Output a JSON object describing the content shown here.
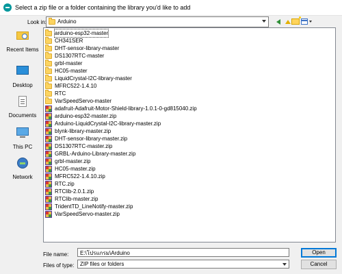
{
  "window": {
    "title": "Select a zip file or a folder containing the library you'd like to add"
  },
  "toolbar": {
    "look_in_label": "Look in:",
    "look_in_value": "Arduino",
    "back_icon": "back-arrow-icon",
    "up_icon": "up-folder-icon",
    "new_folder_icon": "new-folder-icon",
    "view_menu_icon": "view-menu-icon"
  },
  "places": [
    {
      "label": "Recent Items",
      "icon": "recent-items-icon"
    },
    {
      "label": "Desktop",
      "icon": "desktop-icon"
    },
    {
      "label": "Documents",
      "icon": "documents-icon"
    },
    {
      "label": "This PC",
      "icon": "this-pc-icon"
    },
    {
      "label": "Network",
      "icon": "network-icon"
    }
  ],
  "files": [
    {
      "name": "arduino-esp32-master",
      "type": "folder"
    },
    {
      "name": "CH341SER",
      "type": "folder"
    },
    {
      "name": "DHT-sensor-library-master",
      "type": "folder"
    },
    {
      "name": "DS1307RTC-master",
      "type": "folder"
    },
    {
      "name": "grbl-master",
      "type": "folder"
    },
    {
      "name": "HC05-master",
      "type": "folder"
    },
    {
      "name": "LiquidCrystal-I2C-library-master",
      "type": "folder"
    },
    {
      "name": "MFRC522-1.4.10",
      "type": "folder"
    },
    {
      "name": "RTC",
      "type": "folder"
    },
    {
      "name": "VarSpeedServo-master",
      "type": "folder"
    },
    {
      "name": "adafruit-Adafruit-Motor-Shield-library-1.0.1-0-gd815040.zip",
      "type": "zip"
    },
    {
      "name": "arduino-esp32-master.zip",
      "type": "zip"
    },
    {
      "name": "Arduino-LiquidCrystal-I2C-library-master.zip",
      "type": "zip"
    },
    {
      "name": "blynk-library-master.zip",
      "type": "zip"
    },
    {
      "name": "DHT-sensor-library-master.zip",
      "type": "zip"
    },
    {
      "name": "DS1307RTC-master.zip",
      "type": "zip"
    },
    {
      "name": "GRBL-Arduino-Library-master.zip",
      "type": "zip"
    },
    {
      "name": "grbl-master.zip",
      "type": "zip"
    },
    {
      "name": "HC05-master.zip",
      "type": "zip"
    },
    {
      "name": "MFRC522-1.4.10.zip",
      "type": "zip"
    },
    {
      "name": "RTC.zip",
      "type": "zip"
    },
    {
      "name": "RTClib-2.0.1.zip",
      "type": "zip"
    },
    {
      "name": "RTClib-master.zip",
      "type": "zip"
    },
    {
      "name": "TridentTD_LineNotify-master.zip",
      "type": "zip"
    },
    {
      "name": "VarSpeedServo-master.zip",
      "type": "zip"
    }
  ],
  "form": {
    "file_name_label": "File name:",
    "file_name_value": "E:\\โปรแกรม\\Arduino",
    "file_type_label": "Files of type:",
    "file_type_value": "ZIP files or folders"
  },
  "buttons": {
    "open": "Open",
    "cancel": "Cancel"
  }
}
